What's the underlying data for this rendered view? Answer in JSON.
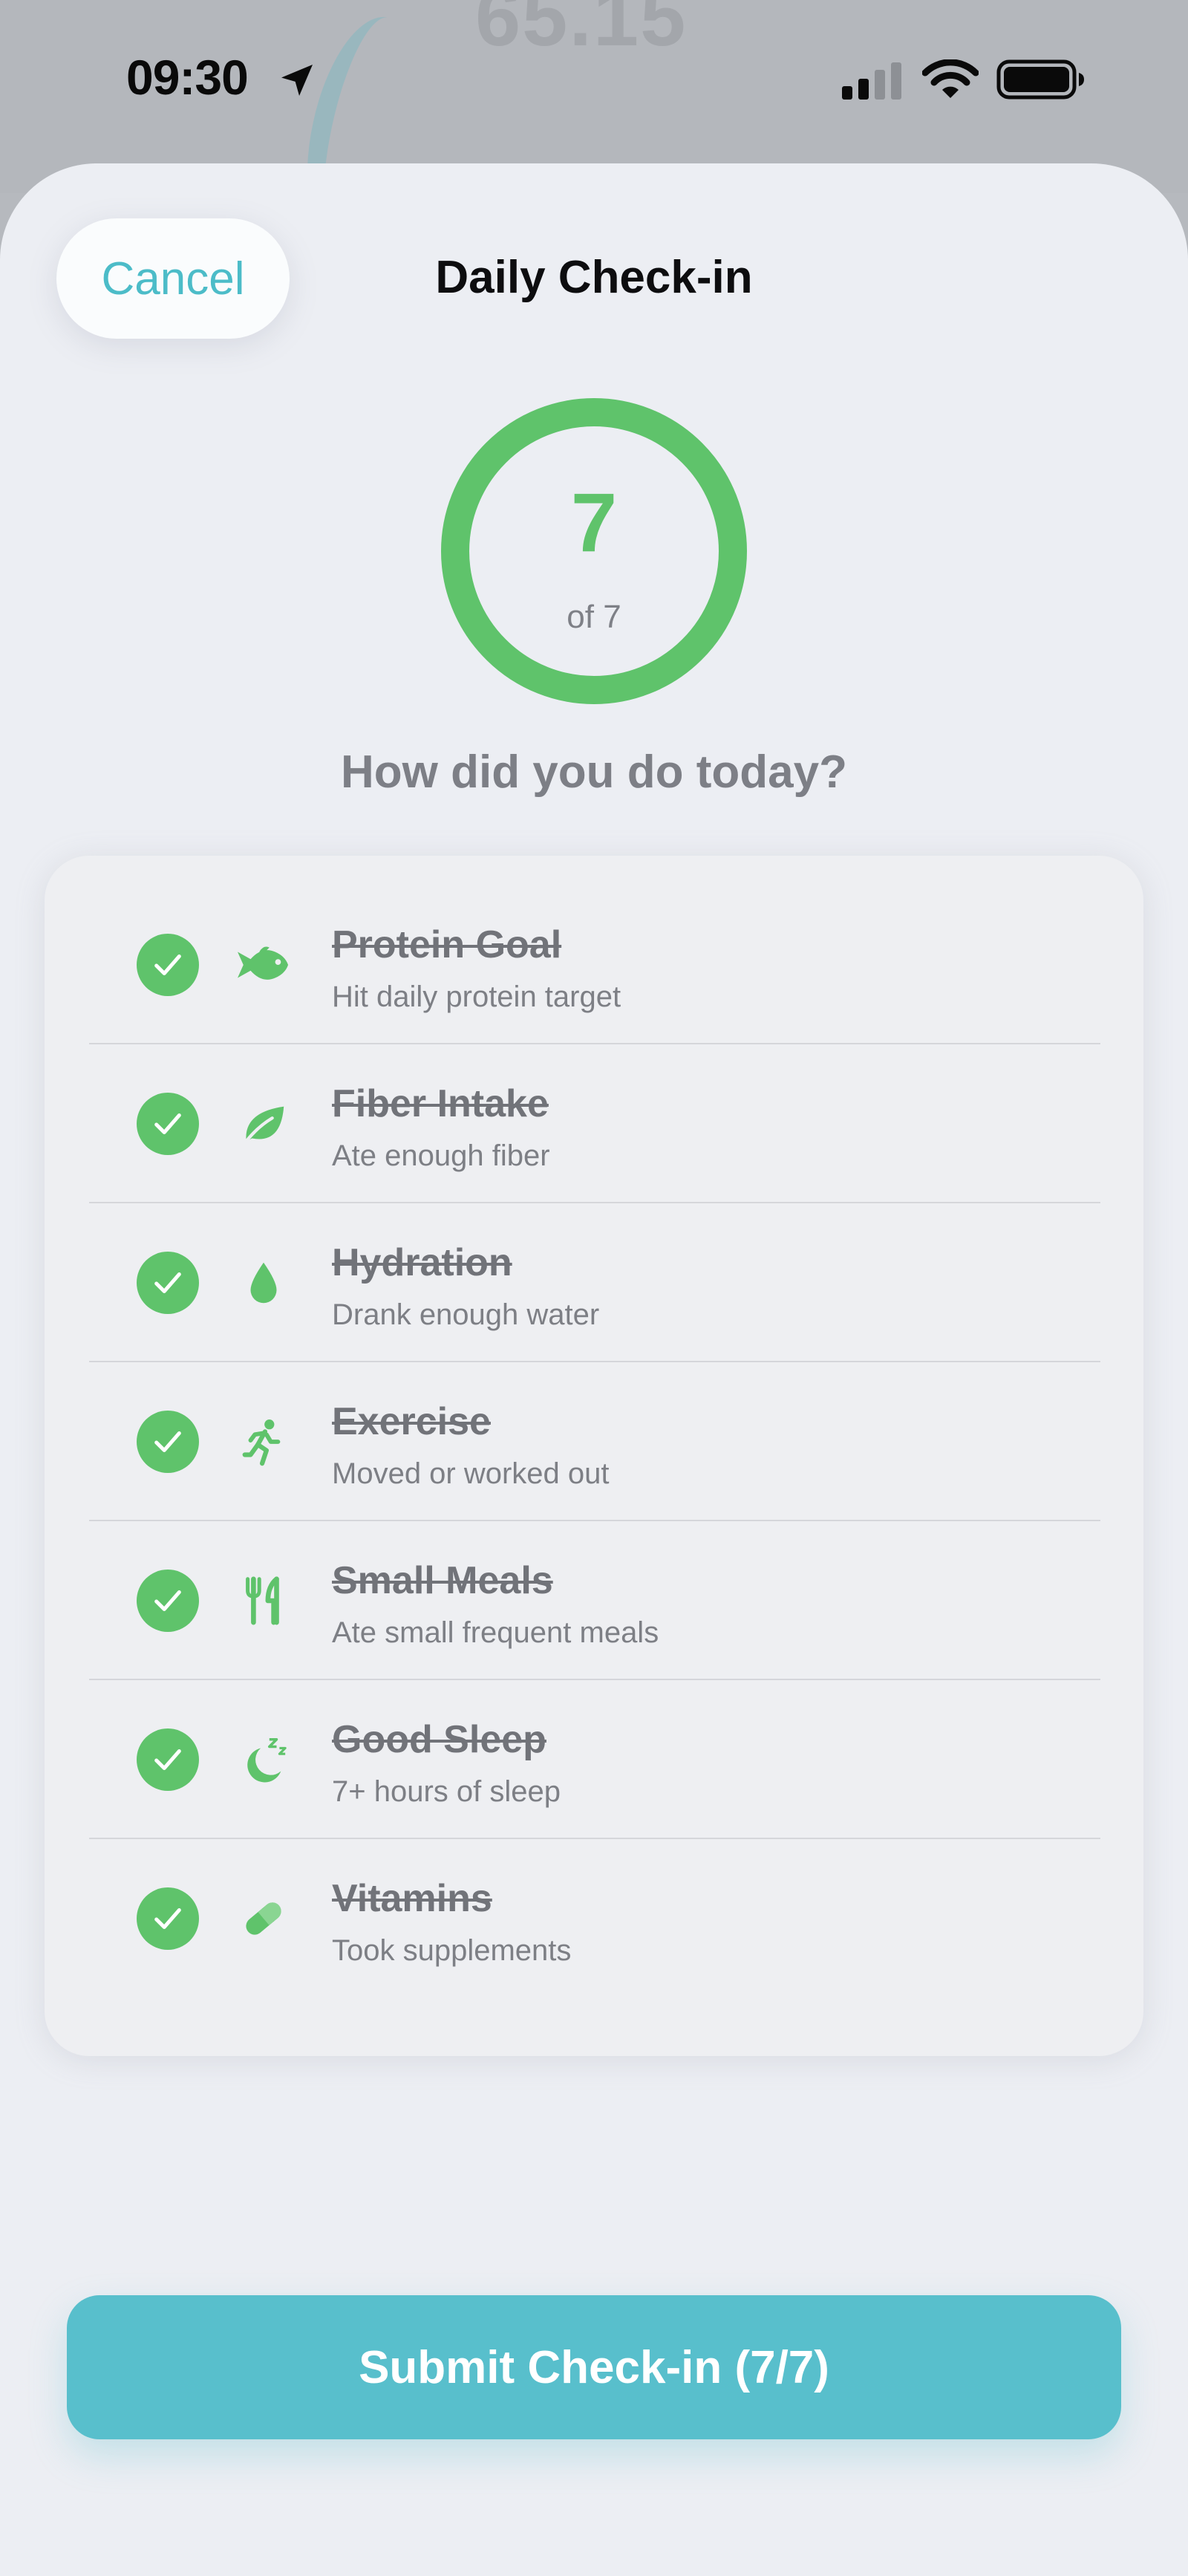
{
  "status_bar": {
    "time": "09:30"
  },
  "backdrop": {
    "number": "65.15"
  },
  "header": {
    "cancel_label": "Cancel",
    "title": "Daily Check-in"
  },
  "progress": {
    "count": "7",
    "total_label": "of 7",
    "completed": 7,
    "total": 7
  },
  "prompt": "How did you do today?",
  "checklist": [
    {
      "title": "Protein Goal",
      "subtitle": "Hit daily protein target",
      "icon": "fish-icon",
      "checked": true
    },
    {
      "title": "Fiber Intake",
      "subtitle": "Ate enough fiber",
      "icon": "leaf-icon",
      "checked": true
    },
    {
      "title": "Hydration",
      "subtitle": "Drank enough water",
      "icon": "water-drop-icon",
      "checked": true
    },
    {
      "title": "Exercise",
      "subtitle": "Moved or worked out",
      "icon": "running-figure-icon",
      "checked": true
    },
    {
      "title": "Small Meals",
      "subtitle": "Ate small frequent meals",
      "icon": "fork-knife-icon",
      "checked": true
    },
    {
      "title": "Good Sleep",
      "subtitle": "7+ hours of sleep",
      "icon": "moon-sleep-icon",
      "checked": true
    },
    {
      "title": "Vitamins",
      "subtitle": "Took supplements",
      "icon": "pill-icon",
      "checked": true
    }
  ],
  "submit_label": "Submit Check-in (7/7)",
  "colors": {
    "accent": "#58bfcc",
    "success": "#5fc36b",
    "cancel_text": "#4cbcc8"
  }
}
